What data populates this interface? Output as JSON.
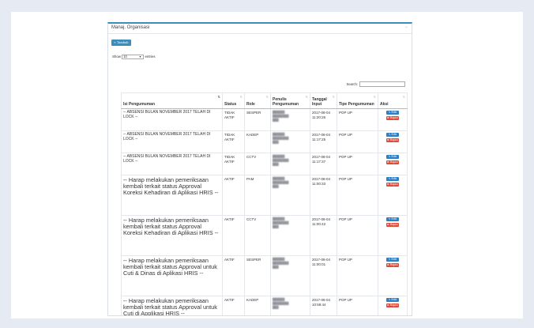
{
  "panel": {
    "title": "Manaj. Organisasi",
    "add_button": "+ Tambah",
    "length_prefix": "Show",
    "length_value": "10",
    "length_suffix": "entries",
    "search_label": "Search:",
    "search_value": ""
  },
  "table": {
    "headers": [
      "Isi Pengumuman",
      "Status",
      "Role",
      "Penulis Pengumuman",
      "Tanggal Input",
      "Tipe Pengumuman",
      "Aksi"
    ],
    "edit_label": "Edit",
    "delete_label": "Hapus",
    "rows": [
      {
        "isi": "-- ABSENSI BULAN NOVEMBER 2017 TELAH DI LOCK --",
        "status": "TIDAK AKTIF",
        "role": "SESPER",
        "penulis": "",
        "tanggal": "2017-08-04 11:20:26",
        "tipe": "POP UP"
      },
      {
        "isi": "-- ABSENSI BULAN NOVEMBER 2017 TELAH DI LOCK --",
        "status": "TIDAK AKTIF",
        "role": "KADEP",
        "penulis": "",
        "tanggal": "2017-08-04 11:17:25",
        "tipe": "POP UP"
      },
      {
        "isi": "-- ABSENSI BULAN NOVEMBER 2017 TELAH DI LOCK --",
        "status": "TIDAK AKTIF",
        "role": "CCTV",
        "penulis": "",
        "tanggal": "2017-08-04 11:17:37",
        "tipe": "POP UP"
      },
      {
        "isi": "-- Harap melakukan pemeriksaan kembali terkait  status Approval Koreksi Kehadiran di Aplikasi HRIS --",
        "status": "AKTIF",
        "role": "PAM",
        "penulis": "",
        "tanggal": "2017-08-04 11:00:33",
        "tipe": "POP UP"
      },
      {
        "isi": "-- Harap melakukan pemeriksaan kembali terkait  status Approval Koreksi Kehadiran di Aplikasi HRIS --",
        "status": "AKTIF",
        "role": "CCTV",
        "penulis": "",
        "tanggal": "2017-08-04 11:00:42",
        "tipe": "POP UP"
      },
      {
        "isi": "-- Harap melakukan pemeriksaan kembali terkait  status Approval untuk Cuti & Dinas di Aplikasi HRIS  --",
        "status": "AKTIF",
        "role": "SESPER",
        "penulis": "",
        "tanggal": "2017-08-04 11:00:01",
        "tipe": "POP UP"
      },
      {
        "isi": "-- Harap melakukan pemeriksaan kembali terkait  status Approval untuk Cuti di Applikasi HRIS  --",
        "status": "AKTIF",
        "role": "KADEP",
        "penulis": "",
        "tanggal": "2017-08-04 10:59:44",
        "tipe": "POP UP"
      }
    ]
  }
}
